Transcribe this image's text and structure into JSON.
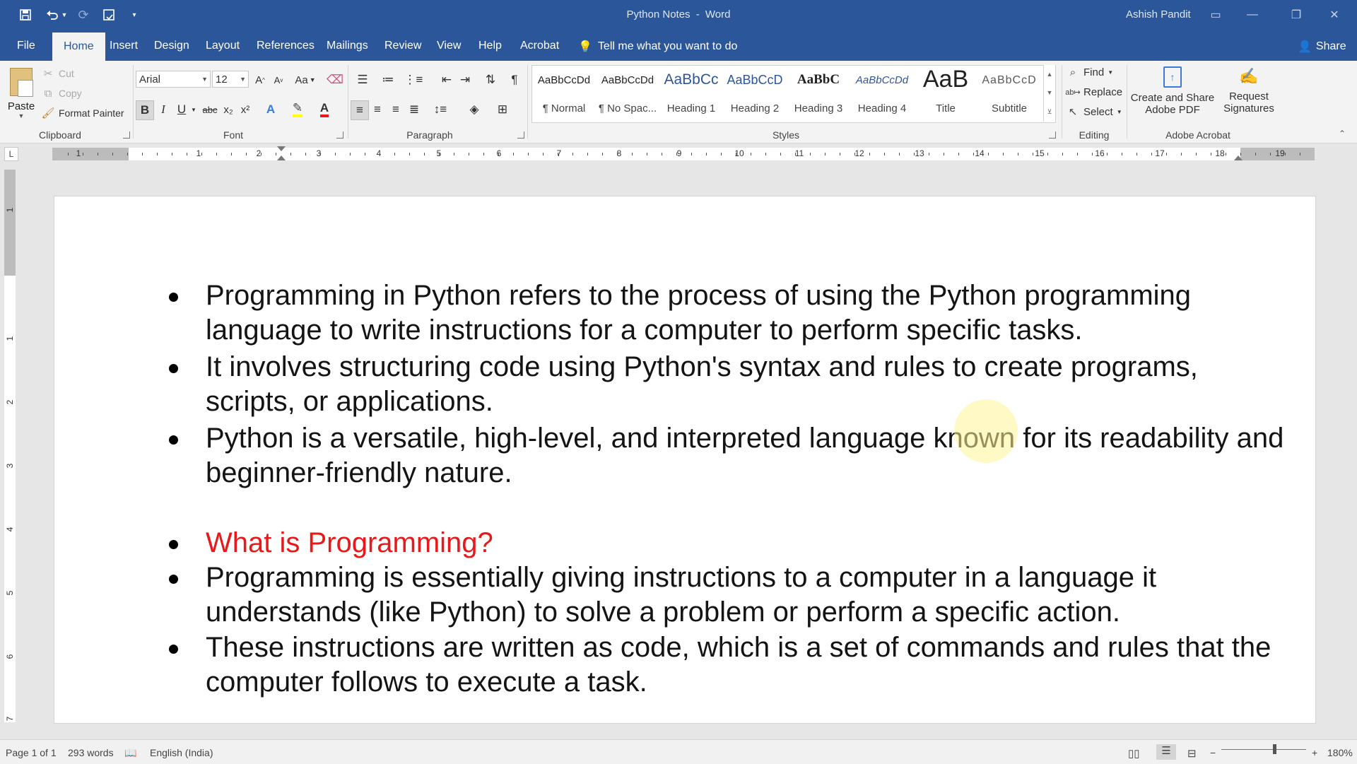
{
  "window": {
    "doc_title": "Python Notes",
    "separator": "-",
    "app_name": "Word",
    "user_name": "Ashish Pandit",
    "accent_color": "#2b579a"
  },
  "tabs": [
    "File",
    "Home",
    "Insert",
    "Design",
    "Layout",
    "References",
    "Mailings",
    "Review",
    "View",
    "Help",
    "Acrobat"
  ],
  "active_tab": "Home",
  "tell_me": "Tell me what you want to do",
  "share": "Share",
  "clipboard": {
    "paste": "Paste",
    "cut": "Cut",
    "copy": "Copy",
    "format_painter": "Format Painter",
    "group_label": "Clipboard"
  },
  "font": {
    "name": "Arial",
    "size": "12",
    "case_label": "Aa",
    "group_label": "Font",
    "bold": "B",
    "italic": "I",
    "underline": "U",
    "strikethrough": "abc",
    "subscript": "x₂",
    "superscript": "x²"
  },
  "paragraph": {
    "group_label": "Paragraph"
  },
  "styles": {
    "group_label": "Styles",
    "items": [
      {
        "sample": "AaBbCcDd",
        "name": "¶ Normal"
      },
      {
        "sample": "AaBbCcDd",
        "name": "¶ No Spac..."
      },
      {
        "sample": "AaBbCc",
        "name": "Heading 1"
      },
      {
        "sample": "AaBbCcD",
        "name": "Heading 2"
      },
      {
        "sample": "AaBbC",
        "name": "Heading 3"
      },
      {
        "sample": "AaBbCcDd",
        "name": "Heading 4"
      },
      {
        "sample": "AaB",
        "name": "Title"
      },
      {
        "sample": "AaBbCcD",
        "name": "Subtitle"
      }
    ]
  },
  "editing": {
    "find": "Find",
    "replace": "Replace",
    "select": "Select",
    "group_label": "Editing"
  },
  "acrobat": {
    "create_share_line1": "Create and Share",
    "create_share_line2": "Adobe PDF",
    "request_line1": "Request",
    "request_line2": "Signatures",
    "group_label": "Adobe Acrobat"
  },
  "ruler": {
    "tab_selector": "L",
    "numbers": [
      "1",
      "1",
      "2",
      "3",
      "4",
      "5",
      "6",
      "7",
      "8",
      "9",
      "10",
      "11",
      "12",
      "13",
      "14",
      "15",
      "16",
      "17",
      "18",
      "19"
    ],
    "vertical_numbers": [
      "1",
      "1",
      "2",
      "3",
      "4",
      "5",
      "6",
      "7"
    ]
  },
  "document": {
    "bullets": [
      {
        "text": "Programming in Python refers to the process of using the Python programming language to write instructions for a computer to perform specific tasks.",
        "style": "normal"
      },
      {
        "text": "It involves structuring code using Python's syntax and rules to create programs, scripts, or applications.",
        "style": "normal"
      },
      {
        "text": "Python is a versatile, high-level, and interpreted language known for its readability and beginner-friendly nature.",
        "style": "normal"
      },
      {
        "text": "What is Programming?",
        "style": "heading",
        "color": "#e8191b"
      },
      {
        "text": "Programming is essentially giving instructions to a computer in a language it understands (like Python) to solve a problem or perform a specific action.",
        "style": "normal"
      },
      {
        "text": "These instructions are written as code, which is a set of commands and rules that the computer follows to execute a task.",
        "style": "normal"
      }
    ]
  },
  "status": {
    "page": "Page 1 of 1",
    "words": "293 words",
    "language": "English (India)",
    "zoom": "180%"
  }
}
